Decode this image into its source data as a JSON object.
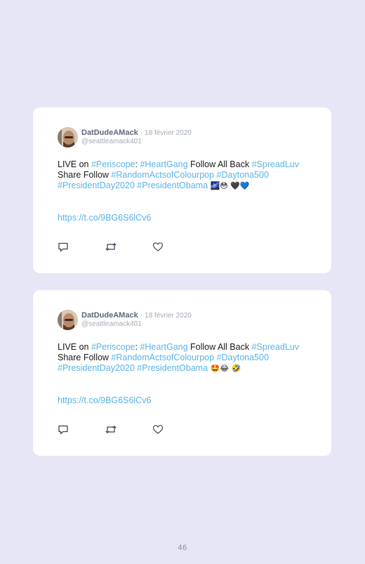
{
  "tweets": [
    {
      "author_name": "DatDudeAMack",
      "separator": "·",
      "date": "18 février 2020",
      "handle": "@seattleamack401",
      "body_segments": [
        {
          "text": "LIVE on ",
          "kind": "text"
        },
        {
          "text": "#Periscope",
          "kind": "tag"
        },
        {
          "text": ": ",
          "kind": "text"
        },
        {
          "text": "#HeartGang",
          "kind": "tag"
        },
        {
          "text": " Follow All Back ",
          "kind": "text"
        },
        {
          "text": "#SpreadLuv",
          "kind": "tag"
        },
        {
          "text": " Share Follow ",
          "kind": "text"
        },
        {
          "text": "#RandomActsofColourpop",
          "kind": "tag"
        },
        {
          "text": " ",
          "kind": "text"
        },
        {
          "text": "#Daytona500",
          "kind": "tag"
        },
        {
          "text": " ",
          "kind": "text"
        },
        {
          "text": "#PresidentDay2020",
          "kind": "tag"
        },
        {
          "text": " ",
          "kind": "text"
        },
        {
          "text": "#PresidentObama",
          "kind": "tag"
        },
        {
          "text": " 🌌😳 🖤💙",
          "kind": "emoji"
        }
      ],
      "link": "https://t.co/9BG6S6lCv6"
    },
    {
      "author_name": "DatDudeAMack",
      "separator": "·",
      "date": "18 février 2020",
      "handle": "@seattleamack401",
      "body_segments": [
        {
          "text": "LIVE on ",
          "kind": "text"
        },
        {
          "text": "#Periscope",
          "kind": "tag"
        },
        {
          "text": ": ",
          "kind": "text"
        },
        {
          "text": "#HeartGang",
          "kind": "tag"
        },
        {
          "text": " Follow All Back ",
          "kind": "text"
        },
        {
          "text": "#SpreadLuv",
          "kind": "tag"
        },
        {
          "text": " Share Follow ",
          "kind": "text"
        },
        {
          "text": "#RandomActsofColourpop",
          "kind": "tag"
        },
        {
          "text": " ",
          "kind": "text"
        },
        {
          "text": "#Daytona500",
          "kind": "tag"
        },
        {
          "text": " ",
          "kind": "text"
        },
        {
          "text": "#PresidentDay2020",
          "kind": "tag"
        },
        {
          "text": " ",
          "kind": "text"
        },
        {
          "text": "#PresidentObama",
          "kind": "tag"
        },
        {
          "text": " 🤩😂 🤣",
          "kind": "emoji"
        }
      ],
      "link": "https://t.co/9BG6S6lCv6"
    }
  ],
  "icons": {
    "reply": "reply-icon",
    "retweet": "retweet-icon",
    "like": "heart-icon"
  },
  "colors": {
    "background": "#e6e6f7",
    "card": "#ffffff",
    "hashtag": "#5bb5e8",
    "name": "#5d6a7c",
    "meta": "#a4abb6"
  },
  "page_number": "46"
}
